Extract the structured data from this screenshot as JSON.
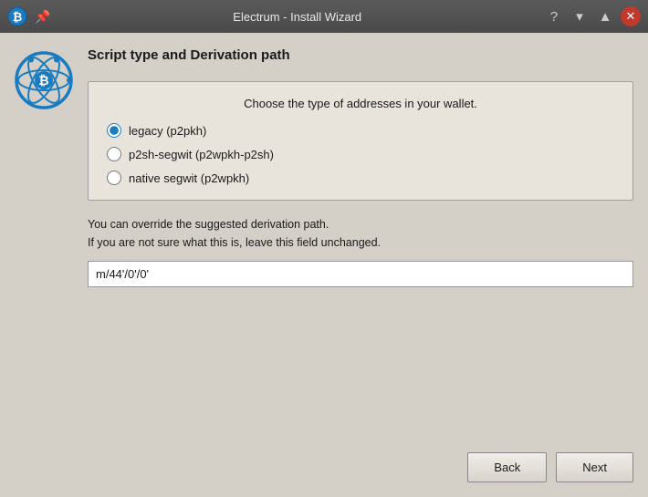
{
  "titlebar": {
    "title": "Electrum - Install Wizard",
    "help_icon": "?",
    "minimize_icon": "▾",
    "maximize_icon": "▲",
    "close_icon": "✕",
    "pin_icon": "📌"
  },
  "section": {
    "title": "Script type and Derivation path",
    "subtitle": "Choose the type of addresses in your wallet.",
    "radio_options": [
      {
        "id": "legacy",
        "label": "legacy (p2pkh)",
        "checked": true
      },
      {
        "id": "p2sh-segwit",
        "label": "p2sh-segwit (p2wpkh-p2sh)",
        "checked": false
      },
      {
        "id": "native-segwit",
        "label": "native segwit (p2wpkh)",
        "checked": false
      }
    ],
    "derivation_hint_line1": "You can override the suggested derivation path.",
    "derivation_hint_line2": "If you are not sure what this is, leave this field unchanged.",
    "derivation_path_value": "m/44'/0'/0'"
  },
  "buttons": {
    "back_label": "Back",
    "next_label": "Next"
  }
}
